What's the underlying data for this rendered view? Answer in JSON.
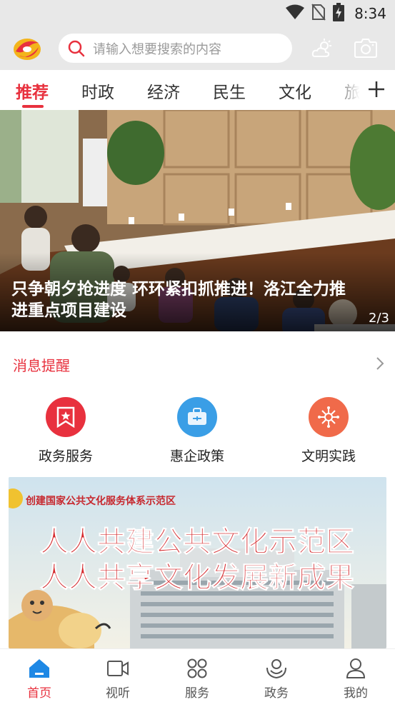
{
  "status_bar": {
    "time": "8:34",
    "icons": [
      "wifi-icon",
      "no-sim-icon",
      "battery-charging-icon"
    ]
  },
  "header": {
    "logo": "app-logo",
    "search": {
      "placeholder": "请输入想要搜索的内容",
      "icon": "search-icon"
    },
    "actions": [
      "weather-icon",
      "camera-icon"
    ]
  },
  "tabs": {
    "items": [
      {
        "label": "推荐",
        "active": true
      },
      {
        "label": "时政",
        "active": false
      },
      {
        "label": "经济",
        "active": false
      },
      {
        "label": "民生",
        "active": false
      },
      {
        "label": "文化",
        "active": false
      },
      {
        "label": "旅",
        "active": false
      }
    ],
    "add_icon": "plus-icon"
  },
  "banner": {
    "title": "只争朝夕抢进度 环环紧扣抓推进！洛江全力推进重点项目建设",
    "pager": "2/3"
  },
  "notice": {
    "label": "消息提醒",
    "icon": "chevron-right-icon"
  },
  "quick_entries": [
    {
      "label": "政务服务",
      "icon": "star-flag-icon",
      "color": "#e8313e"
    },
    {
      "label": "惠企政策",
      "icon": "briefcase-icon",
      "color": "#3a9ee6"
    },
    {
      "label": "文明实践",
      "icon": "network-icon",
      "color": "#f06a4a"
    }
  ],
  "promo": {
    "subtitle": "创建国家公共文化服务体系示范区",
    "line1": "人人共建公共文化示范区",
    "line2": "人人共享文化发展新成果"
  },
  "bottom_nav": [
    {
      "label": "首页",
      "icon": "home-icon",
      "active": true
    },
    {
      "label": "视听",
      "icon": "video-icon",
      "active": false
    },
    {
      "label": "服务",
      "icon": "grid-icon",
      "active": false
    },
    {
      "label": "政务",
      "icon": "hands-icon",
      "active": false
    },
    {
      "label": "我的",
      "icon": "user-icon",
      "active": false
    }
  ],
  "colors": {
    "accent": "#e8313e",
    "header_bg": "#e8e8e8"
  }
}
